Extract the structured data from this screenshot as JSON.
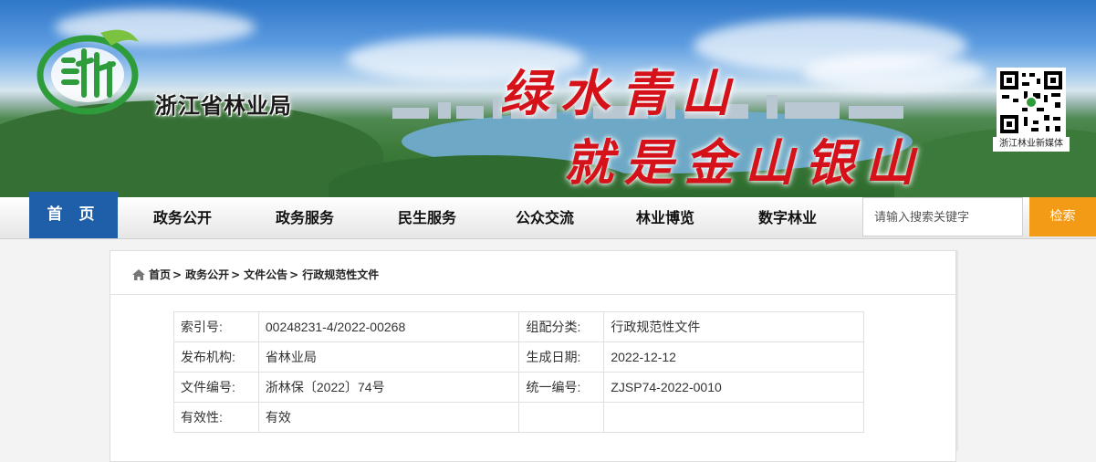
{
  "header": {
    "site_name": "浙江省林业局",
    "slogan_line1": "绿水青山",
    "slogan_line2": "就是金山银山",
    "qr_label": "浙江林业新媒体"
  },
  "nav": {
    "items": [
      "首 页",
      "政务公开",
      "政务服务",
      "民生服务",
      "公众交流",
      "林业博览",
      "数字林业"
    ],
    "search_placeholder": "请输入搜索关键字",
    "search_button": "检索"
  },
  "breadcrumb": [
    "首页",
    "政务公开",
    "文件公告",
    "行政规范性文件"
  ],
  "breadcrumb_sep": ">",
  "metadata": [
    [
      "索引号:",
      "00248231-4/2022-00268",
      "组配分类:",
      "行政规范性文件"
    ],
    [
      "发布机构:",
      "省林业局",
      "生成日期:",
      "2022-12-12"
    ],
    [
      "文件编号:",
      "浙林保〔2022〕74号",
      "统一编号:",
      "ZJSP74-2022-0010"
    ],
    [
      "有效性:",
      "有效",
      "",
      ""
    ]
  ],
  "colors": {
    "nav_active": "#1f5ea8",
    "search_button": "#f39a16",
    "slogan": "#d5111a"
  }
}
